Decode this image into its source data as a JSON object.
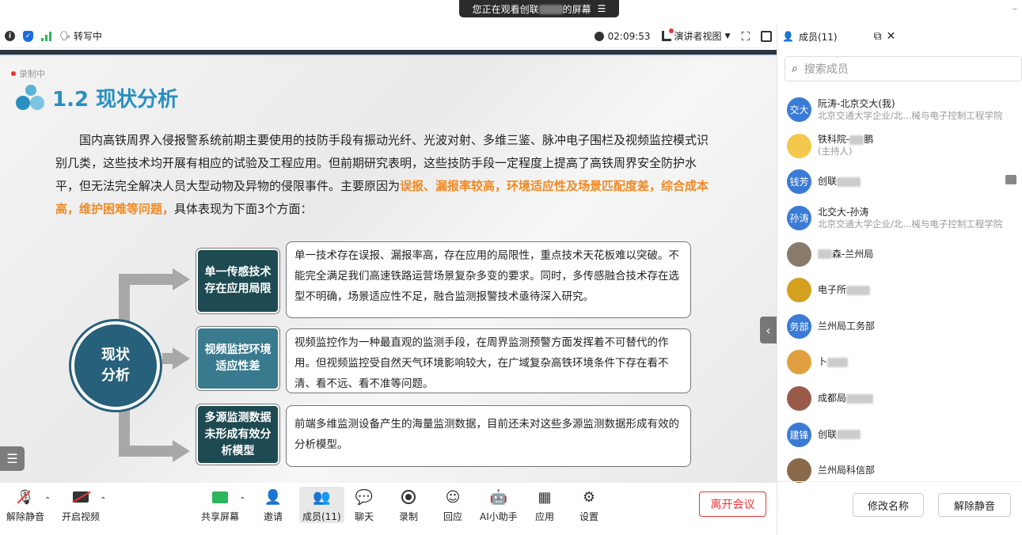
{
  "banner": {
    "text_prefix": "您正在观看创联",
    "text_suffix": "的屏幕",
    "menu_icon": "hamburger-icon"
  },
  "toolbar": {
    "transcribing": "转写中",
    "timer": "02:09:53",
    "presenter_view": "演讲者视图"
  },
  "slide": {
    "recording": "录制中",
    "title": "1.2 现状分析",
    "para_1": "国内高铁周界入侵报警系统前期主要使用的技防手段有振动光纤、光波对射、多维三鉴、脉冲电子围栏及视频监控模式识别几类，这些技术均开展有相应的试验及工程应用。但前期研究表明，这些技防手段一定程度上提高了高铁周界安全防护水平，但无法完全解决人员大型动物及异物的侵限事件。主要原因为",
    "para_highlight": "误报、漏报率较高，环境适应性及场景匹配度差，综合成本高，维护困难等问题，",
    "para_2": "具体表现为下面3个方面：",
    "center_label_1": "现状",
    "center_label_2": "分析",
    "rows": [
      {
        "label": "单一传感技术存在应用局限",
        "desc": "单一技术存在误报、漏报率高，存在应用的局限性，重点技术天花板难以突破。不能完全满足我们高速铁路运营场景复杂多变的要求。同时，多传感融合技术存在选型不明确，场景适应性不足，融合监测报警技术亟待深入研究。"
      },
      {
        "label": "视频监控环境适应性差",
        "desc": "视频监控作为一种最直观的监测手段，在周界监测预警方面发挥着不可替代的作用。但视频监控受自然天气环境影响较大，在广域复杂高铁环境条件下存在看不清、看不远、看不准等问题。"
      },
      {
        "label": "多源监测数据未形成有效分析模型",
        "desc": "前端多维监测设备产生的海量监测数据，目前还未对这些多源监测数据形成有效的分析模型。"
      }
    ]
  },
  "controls": {
    "unmute": "解除静音",
    "start_video": "开启视频",
    "share_screen": "共享屏幕",
    "invite": "邀请",
    "members": "成员(11)",
    "chat": "聊天",
    "record": "录制",
    "reply": "回应",
    "ai_assistant": "AI小助手",
    "apps": "应用",
    "settings": "设置",
    "leave": "离开会议"
  },
  "members_panel": {
    "title": "成员(11)",
    "search_placeholder": "搜索成员",
    "members": [
      {
        "avatar_text": "交大",
        "avatar_color": "#3a7bd5",
        "name": "阮涛-北京交大(我)",
        "sub": "北京交通大学企业/北...械与电子控制工程学院"
      },
      {
        "avatar_text": "",
        "avatar_color": "#f2c94c",
        "name": "铁科院-",
        "name_tail": "鹏",
        "sub": "(主持人)"
      },
      {
        "avatar_text": "钱芳",
        "avatar_color": "#3a7bd5",
        "name": "创联",
        "sub": ""
      },
      {
        "avatar_text": "孙涛",
        "avatar_color": "#3a7bd5",
        "name": "北交大-孙涛",
        "sub": "北京交通大学企业/北...械与电子控制工程学院"
      },
      {
        "avatar_text": "",
        "avatar_color": "#8a7a6a",
        "name": "",
        "name_tail": "森-兰州局",
        "sub": ""
      },
      {
        "avatar_text": "",
        "avatar_color": "#d4a020",
        "name": "电子所",
        "sub": ""
      },
      {
        "avatar_text": "务部",
        "avatar_color": "#3a7bd5",
        "name": "兰州局工务部",
        "sub": ""
      },
      {
        "avatar_text": "",
        "avatar_color": "#e0a040",
        "name": "卜",
        "sub": ""
      },
      {
        "avatar_text": "",
        "avatar_color": "#9a5a4a",
        "name": "成都局",
        "sub": ""
      },
      {
        "avatar_text": "建锋",
        "avatar_color": "#3a7bd5",
        "name": "创联",
        "sub": ""
      },
      {
        "avatar_text": "",
        "avatar_color": "#8a6a4a",
        "name": "兰州局科信部",
        "sub": ""
      }
    ],
    "rename": "修改名称",
    "unmute": "解除静音"
  }
}
